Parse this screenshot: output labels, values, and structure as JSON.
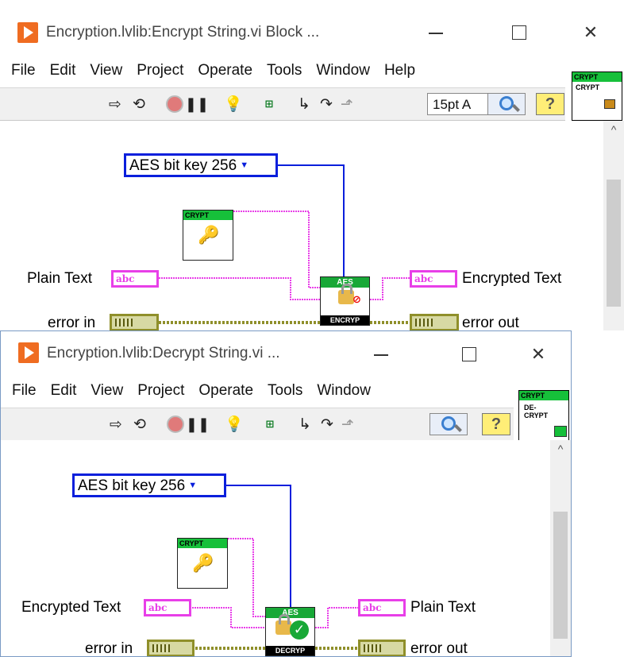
{
  "encrypt_window": {
    "title": "Encryption.lvlib:Encrypt String.vi Block ...",
    "menus": [
      "File",
      "Edit",
      "View",
      "Project",
      "Operate",
      "Tools",
      "Window",
      "Help"
    ],
    "font_ring": "15pt A",
    "connector_label": "CRYPT",
    "connector_sub": "CRYPT",
    "diagram": {
      "key_size_enum": "AES bit key 256",
      "crypt_vi_label": "CRYPT",
      "input_label": "Plain Text",
      "input_type": "abc",
      "output_label": "Encrypted Text",
      "output_type": "abc",
      "error_in_label": "error in",
      "error_out_label": "error out",
      "node_header": "AES",
      "node_footer": "ENCRYP"
    }
  },
  "decrypt_window": {
    "title": "Encryption.lvlib:Decrypt String.vi ...",
    "menus": [
      "File",
      "Edit",
      "View",
      "Project",
      "Operate",
      "Tools",
      "Window"
    ],
    "connector_label": "CRYPT",
    "connector_sub": "DE-CRYPT",
    "diagram": {
      "key_size_enum": "AES bit key 256",
      "crypt_vi_label": "CRYPT",
      "input_label": "Encrypted Text",
      "input_type": "abc",
      "output_label": "Plain Text",
      "output_type": "abc",
      "error_in_label": "error in",
      "error_out_label": "error out",
      "node_header": "AES",
      "node_footer": "DECRYP"
    }
  },
  "colors": {
    "enum_blue": "#0a1fdc",
    "string_pink": "#e83fe8",
    "error_olive": "#8f8f2a",
    "labview_orange": "#ef6c21",
    "vi_green": "#16c03a"
  },
  "icons": {
    "run": "run-arrow-icon",
    "run_continuous": "run-continuously-icon",
    "abort": "abort-icon",
    "pause": "pause-icon",
    "highlight": "highlight-execution-icon",
    "retain_wire": "retain-wire-values-icon",
    "step_into": "step-into-icon",
    "step_over": "step-over-icon",
    "step_out": "step-out-icon",
    "search": "search-icon",
    "help": "context-help-icon"
  }
}
